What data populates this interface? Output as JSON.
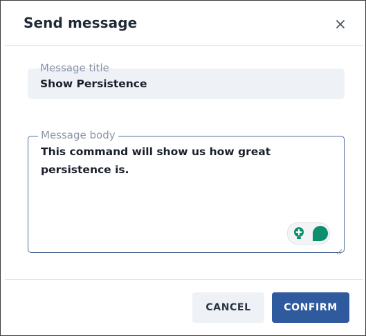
{
  "dialog": {
    "title": "Send message",
    "close_icon": "close-icon"
  },
  "form": {
    "title_field": {
      "label": "Message title",
      "value": "Show Persistence"
    },
    "body_field": {
      "label": "Message body",
      "value": "This command will show us how great persistence is."
    },
    "grammar_widget_icons": [
      "lightbulb-icon",
      "speech-bubble-icon"
    ]
  },
  "footer": {
    "cancel_label": "CANCEL",
    "confirm_label": "CONFIRM"
  },
  "colors": {
    "accent": "#2f5a9e",
    "assistant_green": "#0b8f6f"
  }
}
